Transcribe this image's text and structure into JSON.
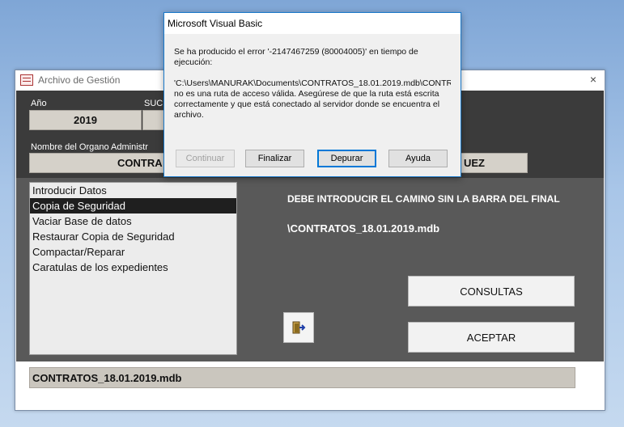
{
  "form": {
    "title": "Archivo de Gestión",
    "close_glyph": "×",
    "header": {
      "year_label": "Año",
      "year_value": "2019",
      "branch_label": "SUCU",
      "branch_value": "",
      "organ_label": "Nombre del Organo Administr",
      "organ_value": "CONTRA",
      "organ_value_right": "UEZ"
    },
    "menu_items": [
      "Introducir Datos",
      "Copia de Seguridad",
      "Vaciar Base de datos",
      "Restaurar Copia de Seguridad",
      "Compactar/Reparar",
      "Caratulas de los expedientes"
    ],
    "selected_menu_index": 1,
    "instruction": "DEBE INTRODUCIR EL CAMINO SIN LA BARRA DEL FINAL",
    "path_text": "\\CONTRATOS_18.01.2019.mdb",
    "consultas_label": "CONSULTAS",
    "aceptar_label": "ACEPTAR",
    "exit_icon": "exit-door-icon",
    "footer_value": "CONTRATOS_18.01.2019.mdb"
  },
  "dialog": {
    "title": "Microsoft Visual Basic",
    "line1": "Se ha producido el error '-2147467259 (80004005)' en tiempo de",
    "line2": "ejecución:",
    "line3": "'C:\\Users\\MANURAK\\Documents\\CONTRATOS_18.01.2019.mdb\\CONTR",
    "line4": "no es una ruta de acceso válida. Asegúrese de que la ruta está escrita",
    "line5": "correctamente y que está conectado al servidor donde se encuentra el",
    "line6": "archivo.",
    "buttons": {
      "continuar": "Continuar",
      "finalizar": "Finalizar",
      "depurar": "Depurar",
      "ayuda": "Ayuda"
    }
  },
  "colors": {
    "header_bg": "#3b3b3b",
    "detail_bg": "#595959",
    "field_bg": "#d5d1c9",
    "dialog_border": "#1979ca"
  }
}
